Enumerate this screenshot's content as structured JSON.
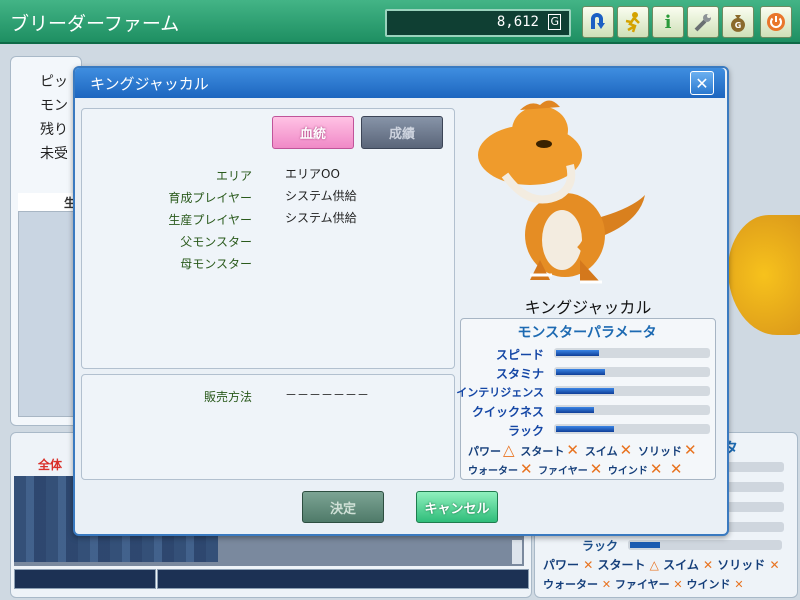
{
  "app": {
    "title": "ブリーダーファーム",
    "money": "8,612",
    "money_unit": "G"
  },
  "toolbar": {
    "buttons": [
      {
        "name": "back-icon"
      },
      {
        "name": "run-icon"
      },
      {
        "name": "info-icon"
      },
      {
        "name": "wrench-icon"
      },
      {
        "name": "money-bag-icon"
      },
      {
        "name": "power-icon"
      }
    ]
  },
  "background": {
    "left_labels": [
      "ピッ",
      "モン",
      "残り",
      "未受"
    ],
    "left_head": "生",
    "tab_all": "全体",
    "right_title": "タ",
    "luck_label": "ラック",
    "luck_value": 0.2,
    "attr_row1": {
      "power": "パワー",
      "start": "スタート",
      "swim": "スイム",
      "solid": "ソリッド"
    },
    "attr_row2": {
      "water": "ウォーター",
      "fire": "ファイヤー",
      "wind": "ウインド"
    }
  },
  "dialog": {
    "title": "キングジャッカル",
    "tabs": {
      "lineage": "血統",
      "record": "成績"
    },
    "fields": [
      {
        "label": "エリア",
        "value": "エリアOO"
      },
      {
        "label": "育成プレイヤー",
        "value": "システム供給"
      },
      {
        "label": "生産プレイヤー",
        "value": "システム供給"
      },
      {
        "label": "父モンスター",
        "value": ""
      },
      {
        "label": "母モンスター",
        "value": ""
      }
    ],
    "sales": {
      "label": "販売方法",
      "value": "－－－－－－－"
    },
    "monster_name": "キングジャッカル",
    "params": {
      "title": "モンスターパラメータ",
      "stats": [
        {
          "label": "スピード",
          "value": 0.28
        },
        {
          "label": "スタミナ",
          "value": 0.32
        },
        {
          "label": "インテリジェンス",
          "value": 0.38
        },
        {
          "label": "クイックネス",
          "value": 0.25
        },
        {
          "label": "ラック",
          "value": 0.38
        }
      ],
      "attributes_row1": [
        {
          "label": "パワー",
          "mark": "△"
        },
        {
          "label": "スタート",
          "mark": "✕"
        },
        {
          "label": "スイム",
          "mark": "✕"
        },
        {
          "label": "ソリッド",
          "mark": "✕"
        }
      ],
      "attributes_row2": [
        {
          "label": "ウォーター",
          "mark": "✕"
        },
        {
          "label": "ファイヤー",
          "mark": "✕"
        },
        {
          "label": "ウインド",
          "mark": "✕"
        }
      ],
      "trailing_mark": "✕"
    },
    "buttons": {
      "decide": "決定",
      "cancel": "キャンセル"
    }
  }
}
